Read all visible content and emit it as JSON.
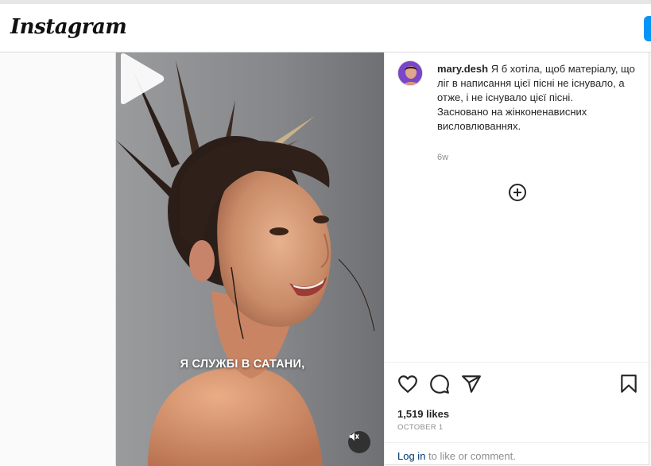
{
  "header": {
    "logo_text": "Instagram"
  },
  "media": {
    "subtitle": "Я СЛУЖБІ В САТАНИ,",
    "play_icon": "play-icon",
    "mute_icon": "muted-speaker-icon"
  },
  "post": {
    "username": "mary.desh",
    "caption_line1": "Я б хотіла, щоб матеріалу, що ліг в написання цієї пісні не існувало, а отже, і не існувало цієї пісні.",
    "caption_line2": "Засновано на жінконенависних висловлюваннях.",
    "time_ago": "6w",
    "likes": "1,519 likes",
    "date": "OCTOBER 1"
  },
  "actions": {
    "like_icon": "heart-icon",
    "comment_icon": "comment-icon",
    "share_icon": "share-icon",
    "save_icon": "bookmark-icon",
    "load_more_icon": "plus-circle-icon"
  },
  "login": {
    "link_text": "Log in",
    "rest_text": " to like or comment."
  },
  "colors": {
    "accent": "#0095f6",
    "link": "#00376b",
    "muted_text": "#8e8e8e"
  }
}
